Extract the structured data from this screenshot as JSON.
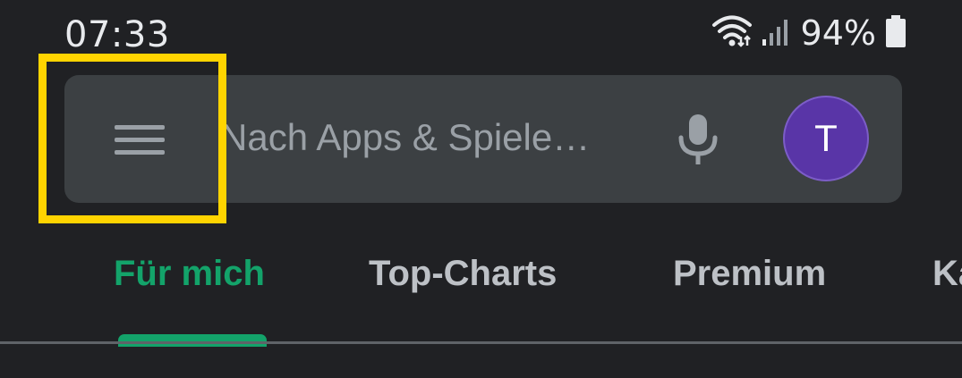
{
  "status_bar": {
    "time": "07:33",
    "battery_percent": "94%",
    "icons": [
      "wifi-icon",
      "signal-icon",
      "battery-icon"
    ]
  },
  "search": {
    "placeholder": "Nach Apps & Spiele…",
    "menu_icon": "hamburger-menu-icon",
    "mic_icon": "microphone-icon",
    "avatar_letter": "T",
    "avatar_color": "#5935a7"
  },
  "tabs": [
    {
      "label": "Für mich",
      "active": true
    },
    {
      "label": "Top-Charts",
      "active": false
    },
    {
      "label": "Premium",
      "active": false
    },
    {
      "label": "Ka",
      "active": false
    }
  ],
  "colors": {
    "background": "#202124",
    "search_bar": "#3c4043",
    "accent": "#13a36a",
    "highlight": "#ffd400"
  }
}
